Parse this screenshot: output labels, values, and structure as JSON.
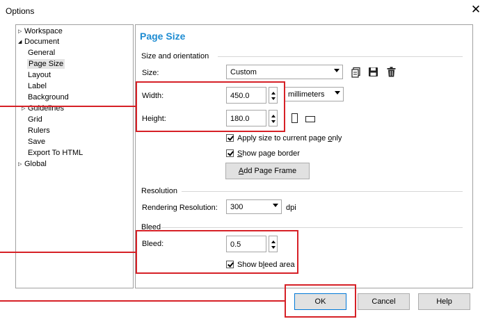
{
  "window": {
    "title": "Options",
    "close_glyph": "✕"
  },
  "tree": {
    "items": [
      {
        "label": "Workspace",
        "twisty": "▷"
      },
      {
        "label": "Document",
        "twisty": "◢"
      },
      {
        "label": "General"
      },
      {
        "label": "Page Size",
        "selected": true
      },
      {
        "label": "Layout"
      },
      {
        "label": "Label"
      },
      {
        "label": "Background"
      },
      {
        "label": "Guidelines",
        "twisty": "▷"
      },
      {
        "label": "Grid"
      },
      {
        "label": "Rulers"
      },
      {
        "label": "Save"
      },
      {
        "label": "Export To HTML"
      },
      {
        "label": "Global",
        "twisty": "▷"
      }
    ]
  },
  "page": {
    "title": "Page Size",
    "size_orientation": {
      "group_label": "Size and orientation",
      "size_label": "Size:",
      "size_value": "Custom",
      "width_label": "Width:",
      "width_value": "450.0",
      "units_value": "millimeters",
      "height_label": "Height:",
      "height_value": "180.0",
      "apply_current_pre": "Apply size to current page ",
      "apply_current_u": "o",
      "apply_current_post": "nly",
      "show_border_pre": "",
      "show_border_u": "S",
      "show_border_post": "how page border",
      "add_frame_pre": "",
      "add_frame_u": "A",
      "add_frame_post": "dd Page Frame"
    },
    "resolution": {
      "group_label": "Resolution",
      "rendering_label": "Rendering Resolution:",
      "rendering_value": "300",
      "unit": "dpi"
    },
    "bleed": {
      "group_label": "Bleed",
      "bleed_label": "Bleed:",
      "bleed_value": "0.5",
      "show_bleed_pre": "Show b",
      "show_bleed_u": "l",
      "show_bleed_post": "eed area"
    }
  },
  "buttons": {
    "ok": "OK",
    "cancel": "Cancel",
    "help": "Help"
  },
  "colors": {
    "accent": "#1e8cd2",
    "highlight": "#d62026"
  }
}
